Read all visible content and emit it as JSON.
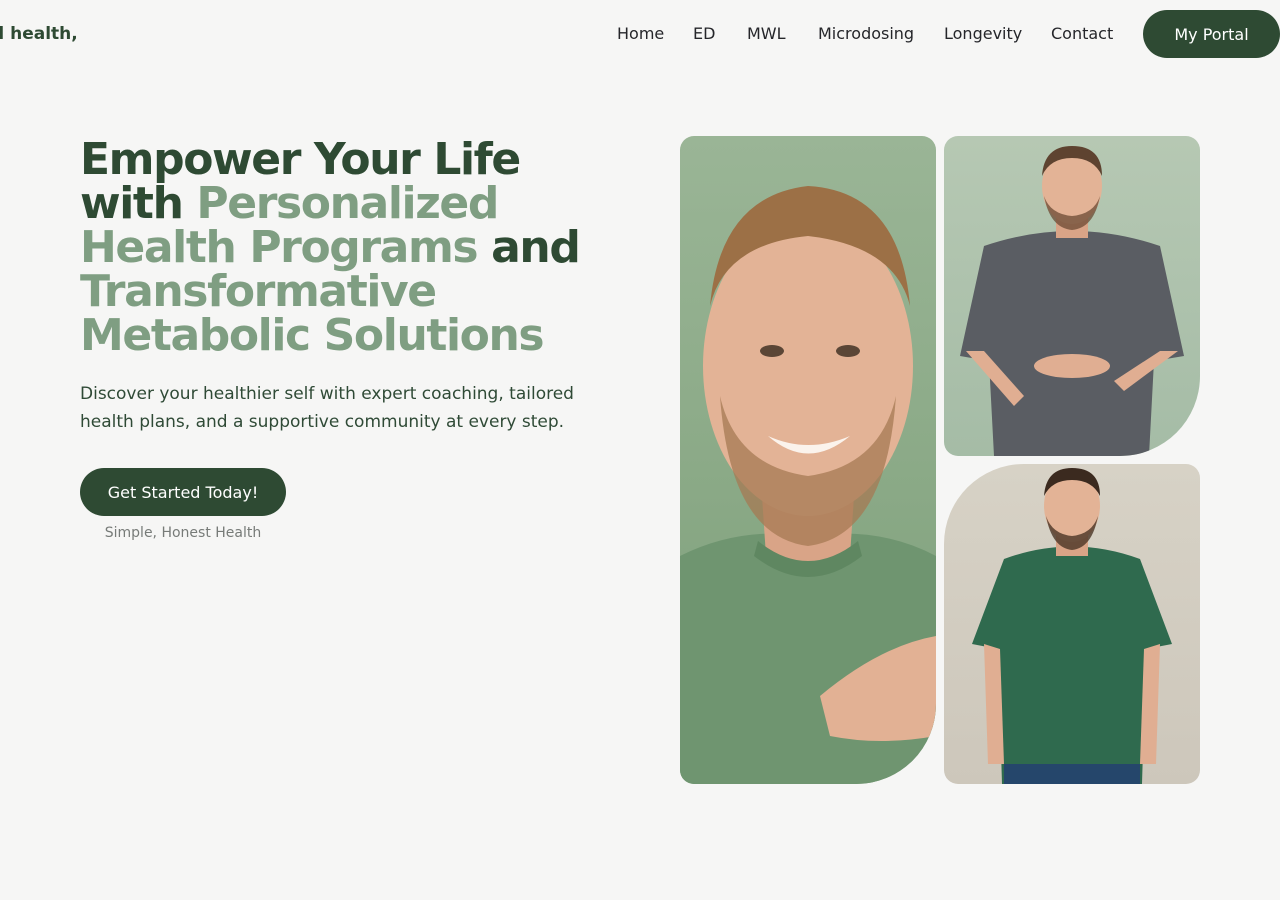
{
  "header": {
    "brand": "d health,",
    "nav": [
      "Home",
      "ED",
      "MWL",
      "Microdosing",
      "Longevity",
      "Contact"
    ],
    "portal_label": "My Portal"
  },
  "hero": {
    "headline": {
      "part1": "Empower Your Life with",
      "highlight1": "Personalized Health Programs",
      "part2": "and",
      "highlight2": "Transformative Metabolic Solutions"
    },
    "subtitle": "Discover your healthier self with expert coaching, tailored health plans, and a supportive community at every step.",
    "cta_label": "Get Started Today!",
    "tagline": "Simple, Honest Health"
  },
  "colors": {
    "brand_dark": "#2e4a33",
    "brand_light": "#7f9e82",
    "background": "#f6f6f5"
  }
}
